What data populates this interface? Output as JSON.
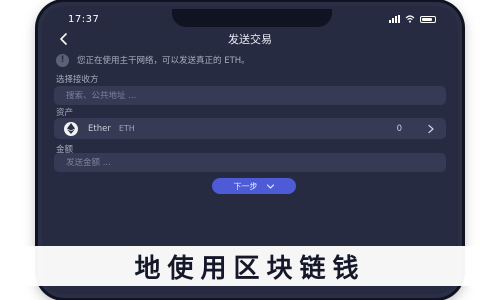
{
  "status_bar": {
    "time": "17:37"
  },
  "nav": {
    "title": "发送交易",
    "back_icon": "chevron-left-icon"
  },
  "network_notice": {
    "text": "您正在使用主干网络，可以发送真正的 ETH。",
    "icon": "info-icon"
  },
  "recipient": {
    "label": "选择接收方",
    "placeholder": "搜索、公共地址 ..."
  },
  "asset": {
    "label": "资产",
    "name": "Ether",
    "symbol": "ETH",
    "balance": "0",
    "icon": "eth-icon"
  },
  "amount": {
    "label": "金额",
    "placeholder": "发送金额 ..."
  },
  "confirm_button": {
    "label": "下一步"
  },
  "banner": {
    "text": "地使用区块链钱"
  },
  "colors": {
    "background": "#262b41",
    "field": "#353b54",
    "accent": "#4d5bd6",
    "text_primary": "#e8ebf5",
    "text_secondary": "#a6abbe"
  }
}
